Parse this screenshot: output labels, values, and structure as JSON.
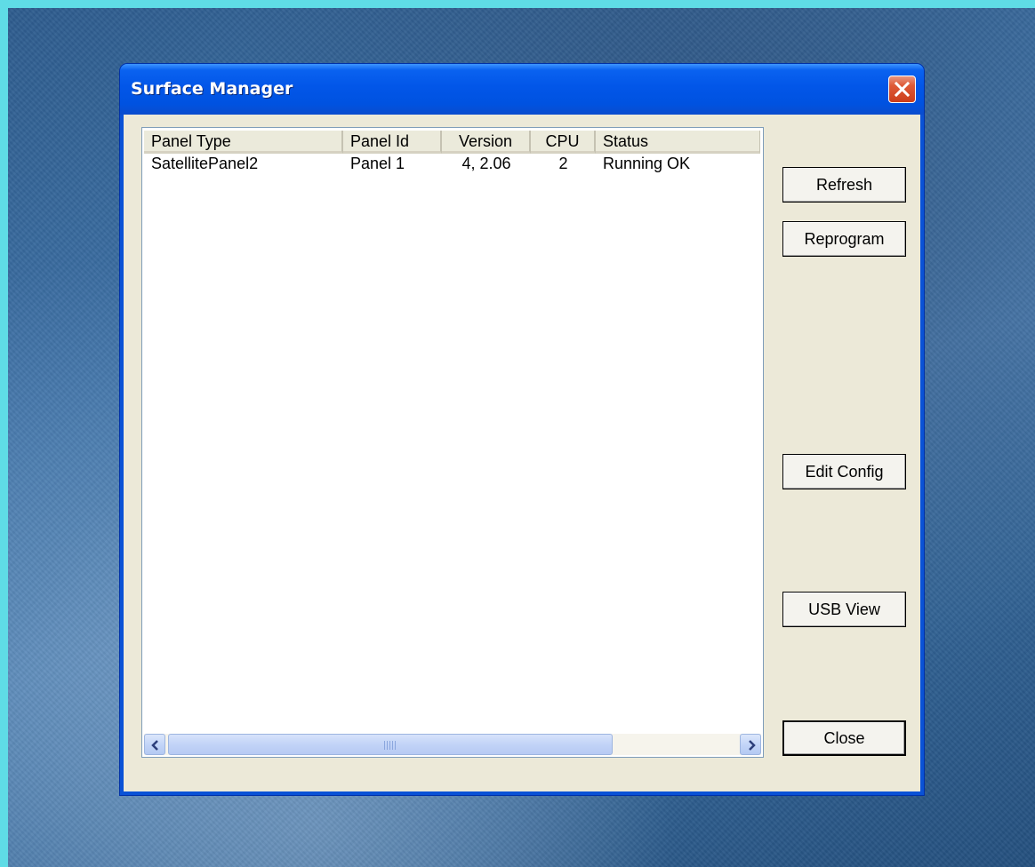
{
  "window": {
    "title": "Surface Manager"
  },
  "listview": {
    "columns": [
      "Panel Type",
      "Panel Id",
      "Version",
      "CPU",
      "Status"
    ],
    "rows": [
      {
        "panel_type": "SatellitePanel2",
        "panel_id": "Panel 1",
        "version": "4, 2.06",
        "cpu": "2",
        "status": "Running OK"
      }
    ]
  },
  "buttons": {
    "refresh": "Refresh",
    "reprogram": "Reprogram",
    "edit_config": "Edit Config",
    "usb_view": "USB View",
    "close": "Close"
  },
  "colors": {
    "titlebar": "#0256e8",
    "window_face": "#ece9d8",
    "desktop_border": "#5fdce6"
  },
  "icons": {
    "close": "close-x-icon",
    "scroll_left": "chevron-left-icon",
    "scroll_right": "chevron-right-icon"
  }
}
